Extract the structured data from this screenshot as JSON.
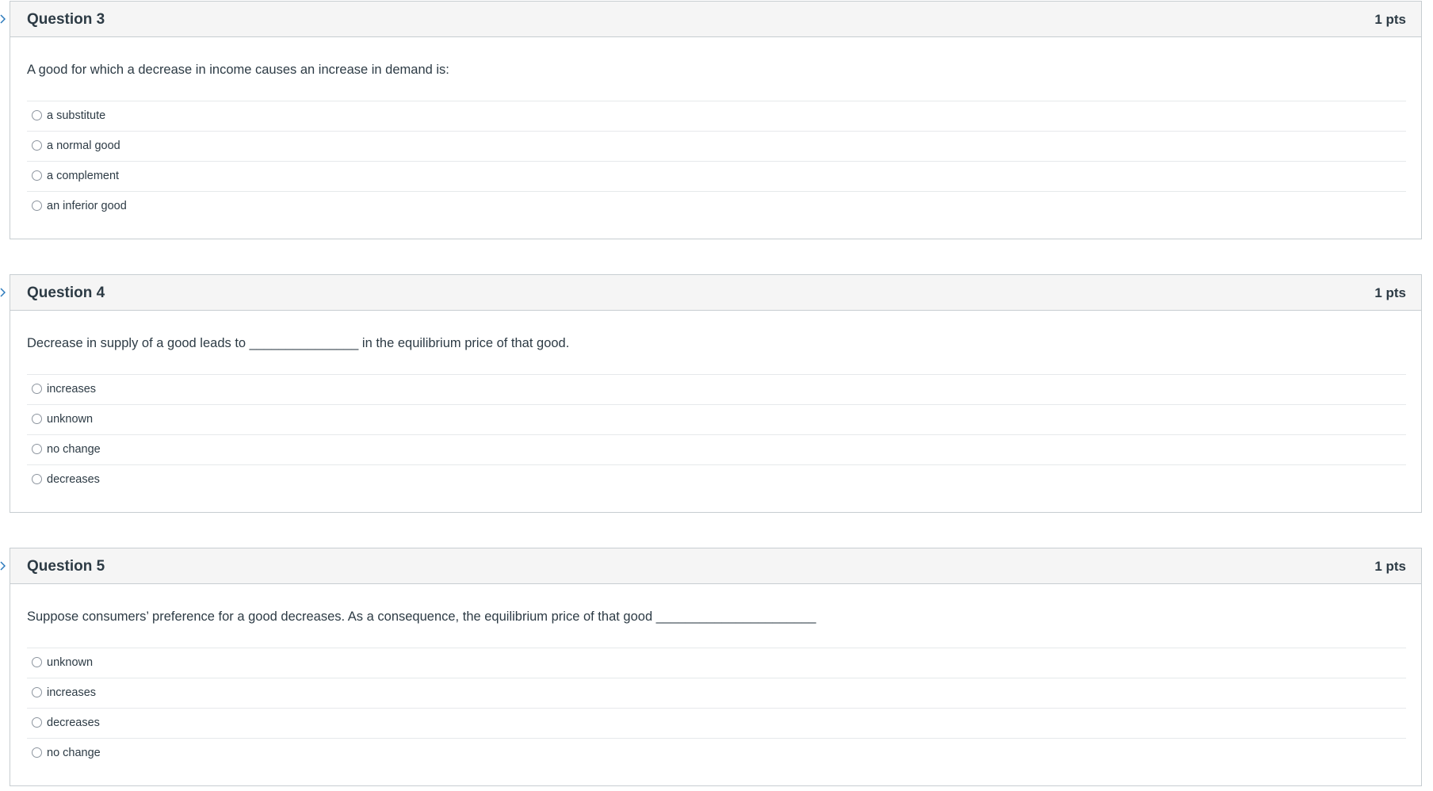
{
  "questions": [
    {
      "title": "Question 3",
      "points": "1 pts",
      "text": "A good for which a decrease in income causes an increase in demand is:",
      "answers": [
        "a substitute",
        "a normal good",
        "a complement",
        "an inferior good"
      ]
    },
    {
      "title": "Question 4",
      "points": "1 pts",
      "text": "Decrease in supply of a good leads to _______________ in the equilibrium price of that good.",
      "answers": [
        "increases",
        "unknown",
        "no change",
        "decreases"
      ]
    },
    {
      "title": "Question 5",
      "points": "1 pts",
      "text": "Suppose consumers’ preference for a good decreases. As a consequence, the equilibrium price of that good ______________________",
      "answers": [
        "unknown",
        "increases",
        "decreases",
        "no change"
      ]
    }
  ],
  "icons": {
    "flag": "bookmark-flag-icon",
    "radio": "radio-button-icon"
  },
  "colors": {
    "text": "#2d3b45",
    "header_bg": "#f5f5f5",
    "border": "#c7cdd1",
    "flag": "#2b7abc"
  }
}
